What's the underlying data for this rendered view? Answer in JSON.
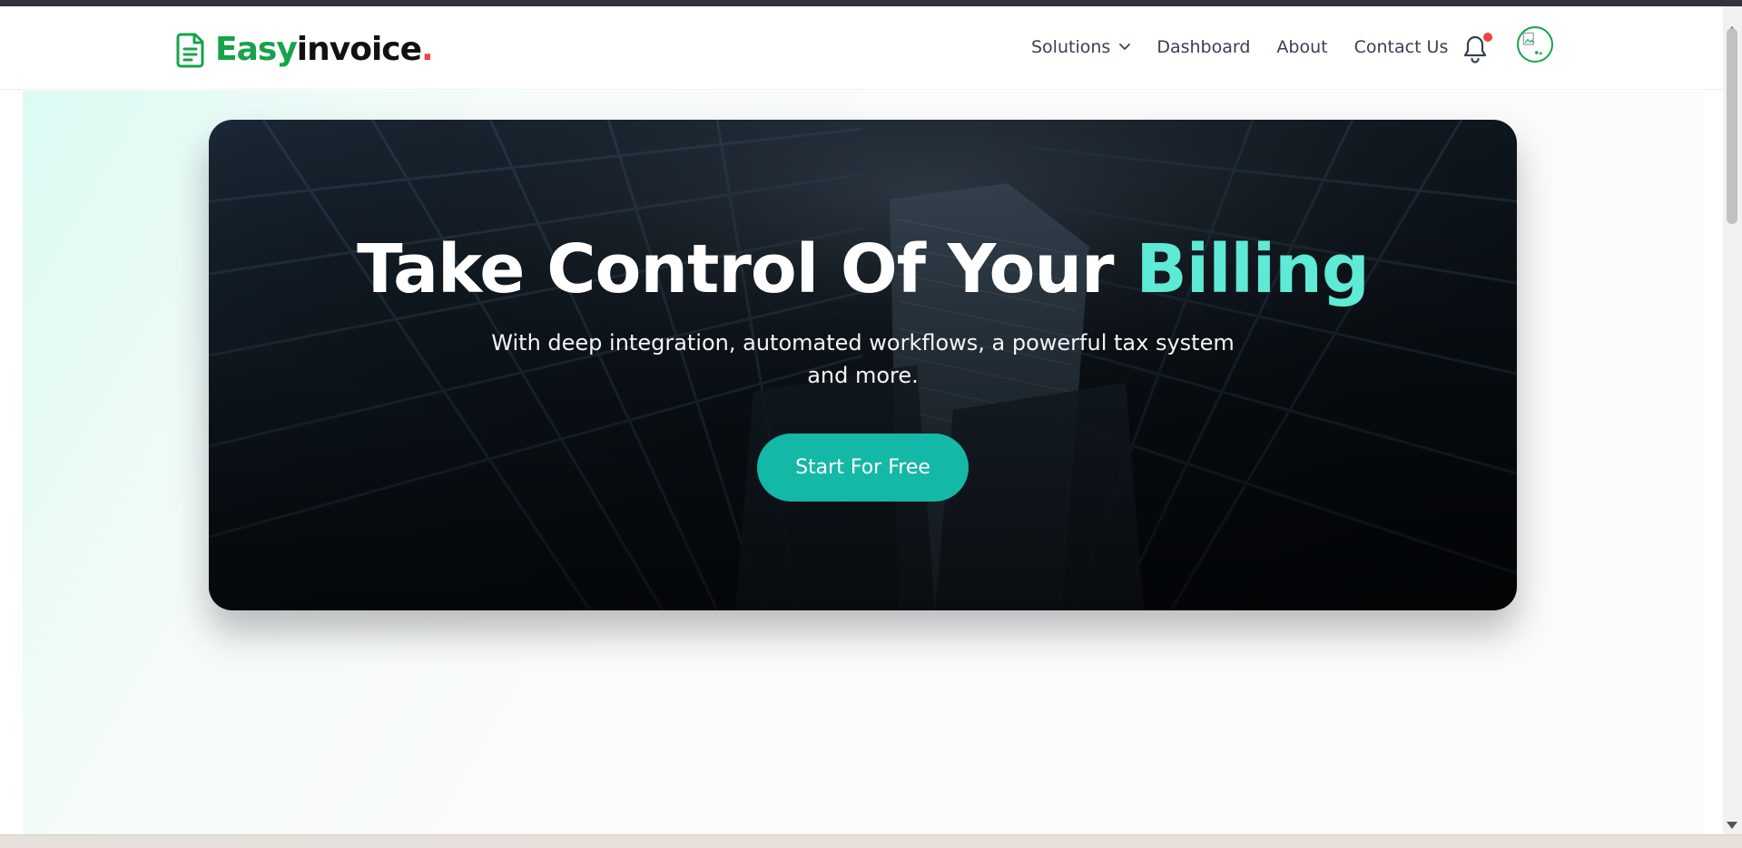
{
  "brand": {
    "name_part1": "Easy",
    "name_part2": "invoice",
    "name_dot": ".",
    "icon": "document-icon",
    "colors": {
      "green": "#16a34a",
      "dark": "#111111",
      "dot": "#ef4444"
    }
  },
  "nav": {
    "items": [
      {
        "label": "Solutions",
        "has_dropdown": true
      },
      {
        "label": "Dashboard"
      },
      {
        "label": "About"
      },
      {
        "label": "Contact Us"
      }
    ],
    "notification_icon": "bell-icon",
    "notification_dot_color": "#ef4444",
    "avatar_icon": "broken-image-icon"
  },
  "hero": {
    "title_main": "Take Control Of Your ",
    "title_accent": "Billing",
    "subtitle": "With deep integration, automated workflows, a powerful tax system and more.",
    "cta_label": "Start For Free",
    "colors": {
      "accent": "#5eead4",
      "button": "#14b8a6"
    }
  }
}
